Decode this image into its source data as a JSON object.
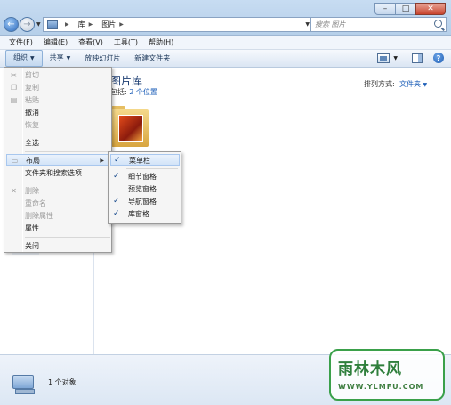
{
  "address": {
    "breadcrumbs": [
      "库",
      "图片"
    ]
  },
  "search": {
    "placeholder": "搜索 图片"
  },
  "menubar": [
    "文件(F)",
    "编辑(E)",
    "查看(V)",
    "工具(T)",
    "帮助(H)"
  ],
  "commands": {
    "organize": "组织",
    "share": "共享",
    "slideshow": "放映幻灯片",
    "new_folder": "新建文件夹"
  },
  "library": {
    "title": "图片库",
    "includes": "包括:",
    "locations": "2 个位置",
    "arrange_label": "排列方式:",
    "arrange_value": "文件夹"
  },
  "organize_menu": {
    "cut": "剪切",
    "copy": "复制",
    "paste": "粘贴",
    "undo": "撤消",
    "redo": "恢复",
    "select_all": "全选",
    "layout": "布局",
    "folder_options": "文件夹和搜索选项",
    "delete": "删除",
    "rename": "重命名",
    "remove_properties": "删除属性",
    "properties": "属性",
    "close": "关闭"
  },
  "layout_submenu": [
    {
      "label": "菜单栏",
      "checked": true
    },
    {
      "label": "细节窗格",
      "checked": true
    },
    {
      "label": "预览窗格",
      "checked": false
    },
    {
      "label": "导航窗格",
      "checked": true
    },
    {
      "label": "库窗格",
      "checked": true
    }
  ],
  "status": {
    "count": "1 个对象"
  },
  "watermark": {
    "main": "雨林木风",
    "url": "WWW.YLMFU.COM"
  }
}
